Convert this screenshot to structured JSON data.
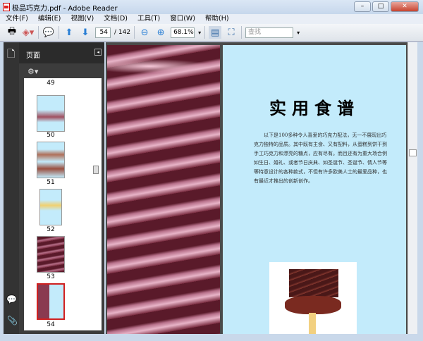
{
  "window": {
    "title": "极品巧克力.pdf - Adobe Reader",
    "minimize": "–",
    "maximize": "□",
    "close": "✕"
  },
  "menu": [
    "文件(F)",
    "编辑(E)",
    "视图(V)",
    "文档(D)",
    "工具(T)",
    "窗口(W)",
    "帮助(H)"
  ],
  "toolbar": {
    "page_current": "54",
    "page_total": "/ 142",
    "zoom": "68.1%",
    "search_placeholder": "查找"
  },
  "panel": {
    "title": "页面",
    "thumbnails": [
      {
        "label": "49"
      },
      {
        "label": "50"
      },
      {
        "label": "51"
      },
      {
        "label": "52"
      },
      {
        "label": "53"
      },
      {
        "label": "54",
        "selected": true
      }
    ]
  },
  "page": {
    "heading": "实用食谱",
    "body": "以下是100多种令人喜爱的巧克力配法，无一不展现出巧克力独特的品质。其中既有主食、又有配料，从蛋糕到饼干到手工巧克力和漂亮的糖点，应有尽有。而且还有为重大场合例如生日、婚礼、或者节日庆典、如圣诞节、圣诞节、情人节等等特意设计的各种款式，不但有许多欧美人士的最爱品种，也有最近才推出的创新创作。"
  },
  "colors": {
    "page_bg": "#c3ebfb",
    "selected_border": "#d02020"
  }
}
